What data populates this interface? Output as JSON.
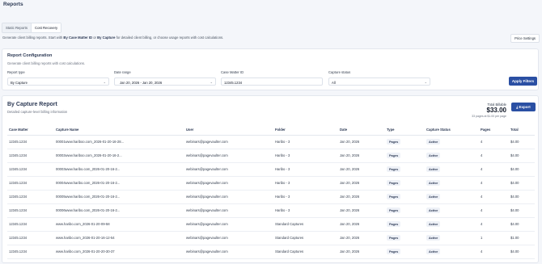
{
  "header": {
    "title": "Reports"
  },
  "tabs": [
    {
      "label": "Static Reports"
    },
    {
      "label": "Cost Recovery"
    }
  ],
  "subtitle": {
    "part1": "Generate client billing reports. Start with ",
    "bold1": "By Case Matter ID",
    "part2": " or ",
    "bold2": "By Capture",
    "part3": " for detailed client billing, or choose usage reports with cost calculations."
  },
  "price_settings_label": "Price Settings",
  "config": {
    "title": "Report Configuration",
    "description": "Generate client billing reports with cost calculations.",
    "report_type": {
      "label": "Report type",
      "value": "By Capture"
    },
    "date_range": {
      "label": "Date range",
      "value": "Jan 20, 2026 - Jan 20, 2026"
    },
    "case_matter_id": {
      "label": "Case Matter ID",
      "value": "12345.1234"
    },
    "capture_status": {
      "label": "Capture status",
      "value": "All"
    },
    "apply_label": "Apply Filters"
  },
  "report": {
    "title": "By Capture Report",
    "description": "Detailed capture-level billing information",
    "total_label": "Total Billable",
    "total_amount": "$33.00",
    "total_sub": "33 pages at $1.00 per page",
    "export_label": "Export",
    "columns": [
      "Case Matter",
      "Capture Name",
      "User",
      "Folder",
      "Date",
      "Type",
      "Capture Status",
      "Pages",
      "Total"
    ],
    "rows": [
      [
        "12345.1234",
        "00001www.hariboo.com_2026-01-20-16-28...",
        "webinars@pagevaulter.com",
        "Haribo - 3",
        "Jan 20, 2026",
        "Pages",
        "Active",
        "4",
        "$4.00"
      ],
      [
        "12345.1234",
        "00002www.hariboo.com_2026-01-20-16-2...",
        "webinars@pagevaulter.com",
        "Haribo - 3",
        "Jan 20, 2026",
        "Pages",
        "Active",
        "4",
        "$4.00"
      ],
      [
        "12345.1234",
        "00003www.haribo.com_2026-01-20-16-2...",
        "webinars@pagevaulter.com",
        "Haribo - 3",
        "Jan 20, 2026",
        "Pages",
        "Active",
        "4",
        "$4.00"
      ],
      [
        "12345.1234",
        "00004www.haribo.com_2026-01-20-16-2...",
        "webinars@pagevaulter.com",
        "Haribo - 3",
        "Jan 20, 2026",
        "Pages",
        "Active",
        "4",
        "$4.00"
      ],
      [
        "12345.1234",
        "00005www.haribo.com_2026-01-20-16-2...",
        "webinars@pagevaulter.com",
        "Haribo - 3",
        "Jan 20, 2026",
        "Pages",
        "Active",
        "4",
        "$4.00"
      ],
      [
        "12345.1234",
        "00006www.haribo.com_2026-01-20-16-2...",
        "webinars@pagevaulter.com",
        "Haribo - 3",
        "Jan 20, 2026",
        "Pages",
        "Active",
        "4",
        "$4.00"
      ],
      [
        "12345.1234",
        "www.haribo.com_2026-01-20-09-58",
        "webinars@pagevaulter.com",
        "Standard Captures",
        "Jan 20, 2026",
        "Pages",
        "Active",
        "4",
        "$4.00"
      ],
      [
        "12345.1234",
        "www.haribo.com_2026-01-20-16-12-54",
        "webinars@pagevaulter.com",
        "Standard Captures",
        "Jan 20, 2026",
        "Pages",
        "Active",
        "1",
        "$1.00"
      ],
      [
        "12345.1234",
        "www.haribo.com_2026-01-20-20-30-37",
        "webinars@pagevaulter.com",
        "Standard Captures",
        "Jan 20, 2026",
        "Pages",
        "Active",
        "4",
        "$4.00"
      ]
    ]
  },
  "colors": {
    "primary": "#2a4fa3",
    "title": "#2d3a55",
    "background": "#f4f6fa"
  },
  "icons": {
    "chevron": "chevron-down-icon",
    "export": "download-icon"
  }
}
